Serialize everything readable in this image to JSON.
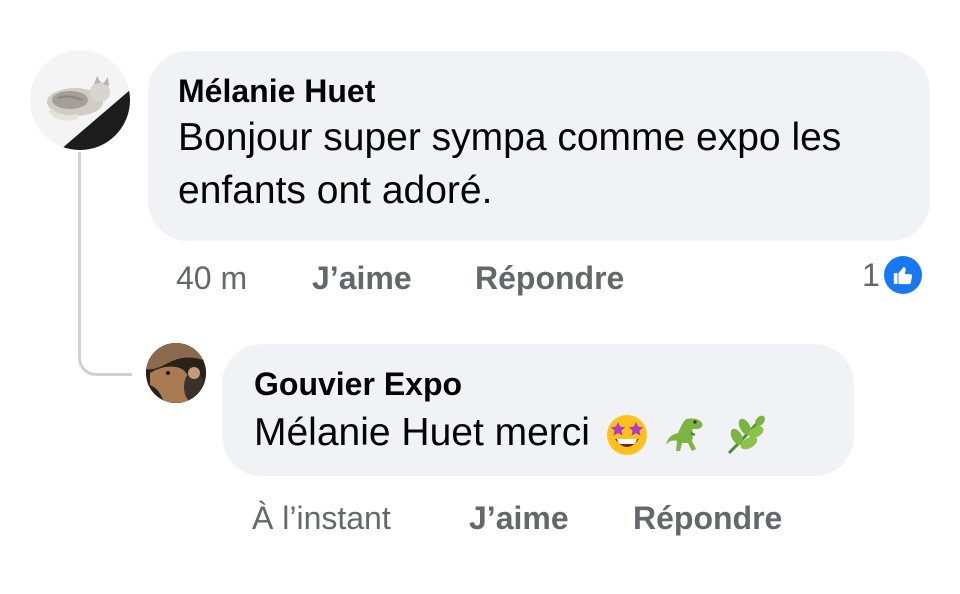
{
  "comment": {
    "author": "Mélanie Huet",
    "text": "Bonjour super sympa comme expo les enfants ont adoré.",
    "timestamp": "40 m",
    "like_label": "J’aime",
    "reply_label": "Répondre",
    "reaction_count": "1",
    "reaction_icon": "like-thumbs-up-icon"
  },
  "reply": {
    "author": "Gouvier Expo",
    "text": "Mélanie Huet merci",
    "emojis": [
      "star-struck-emoji",
      "t-rex-emoji",
      "herb-emoji"
    ],
    "timestamp": "À l’instant",
    "like_label": "J’aime",
    "reply_label": "Répondre"
  },
  "colors": {
    "bubble": "#f0f2f5",
    "secondary_text": "#65676b",
    "like_blue": "#1877f2",
    "thread_line": "#ced0d4"
  }
}
